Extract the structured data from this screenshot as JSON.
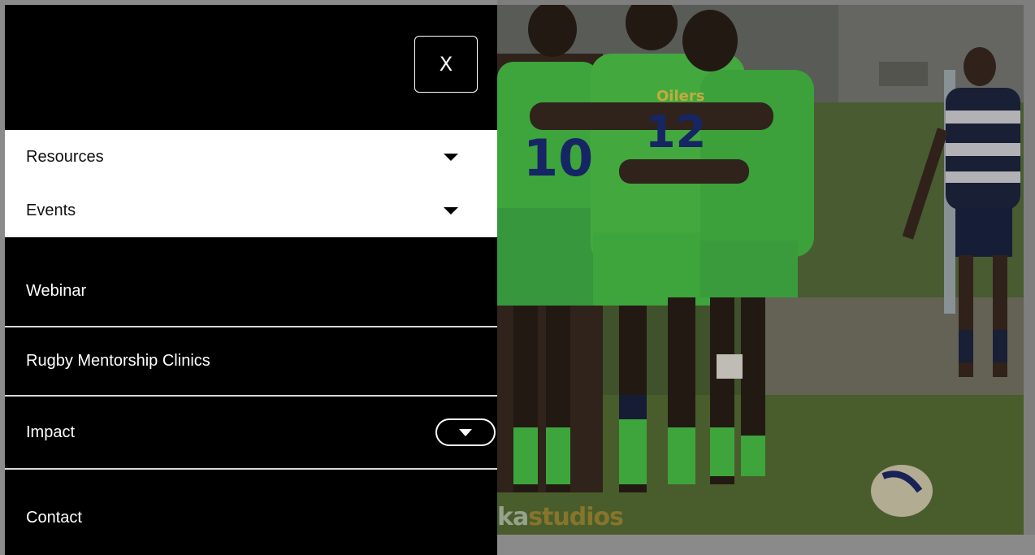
{
  "menu": {
    "close_label": "X",
    "submenu": [
      {
        "label": "Resources",
        "icon": "caret-down-icon"
      },
      {
        "label": "Events",
        "icon": "caret-down-icon"
      }
    ],
    "items": {
      "webinar": "Webinar",
      "rugby": "Rugby Mentorship Clinics",
      "impact": "Impact",
      "contact": "Contact"
    }
  },
  "photo": {
    "watermark_prefix": "ka",
    "watermark_suffix": "studios",
    "jersey_numbers": [
      "10",
      "12"
    ],
    "team_name": "Oilers"
  },
  "colors": {
    "menu_bg": "#000000",
    "submenu_bg": "#ffffff",
    "jersey_green": "#4cc94a",
    "overlay": "#8b8b8b"
  }
}
